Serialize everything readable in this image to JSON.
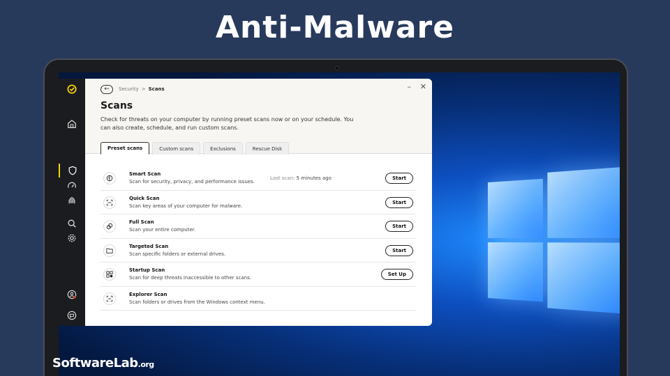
{
  "headline": "Anti-Malware",
  "brand": {
    "name": "SoftwareLab",
    "tld": ".org"
  },
  "app": {
    "breadcrumb": [
      "Security",
      "Scans"
    ],
    "breadcrumb_sep": ">",
    "title": "Scans",
    "description": "Check for threats on your computer by running preset scans now or on your schedule. You can also create, schedule, and run custom scans.",
    "window_controls": {
      "minimize": "–",
      "close": "✕"
    },
    "tabs": [
      {
        "label": "Preset scans",
        "active": true
      },
      {
        "label": "Custom scans",
        "active": false
      },
      {
        "label": "Exclusions",
        "active": false
      },
      {
        "label": "Rescue Disk",
        "active": false
      }
    ],
    "scans": [
      {
        "name": "Smart Scan",
        "description": "Scan for security, privacy, and performance issues.",
        "last_scan_label": "Last scan:",
        "last_scan_value": "5 minutes ago",
        "button": "Start",
        "icon": "shield-scan-icon"
      },
      {
        "name": "Quick Scan",
        "description": "Scan key areas of your computer for malware.",
        "button": "Start",
        "icon": "quick-scan-icon"
      },
      {
        "name": "Full Scan",
        "description": "Scan your entire computer.",
        "button": "Start",
        "icon": "full-scan-icon"
      },
      {
        "name": "Targeted Scan",
        "description": "Scan specific folders or external drives.",
        "button": "Start",
        "icon": "folder-icon"
      },
      {
        "name": "Startup Scan",
        "description": "Scan for deep threats inaccessible to other scans.",
        "button": "Set Up",
        "icon": "startup-icon"
      },
      {
        "name": "Explorer Scan",
        "description": "Scan folders or drives from the Windows context menu.",
        "icon": "explorer-scan-icon"
      }
    ],
    "sidebar_icons": [
      "logo-check-icon",
      "home-icon",
      "shield-icon",
      "performance-gauge-icon",
      "fingerprint-icon",
      "search-icon",
      "gear-icon",
      "account-icon",
      "chat-icon"
    ],
    "colors": {
      "accent": "#f5d20a",
      "sidebar": "#1b1c1f"
    }
  }
}
